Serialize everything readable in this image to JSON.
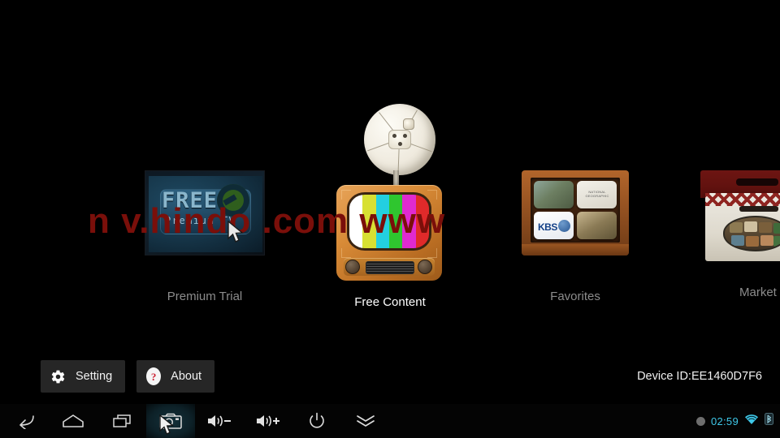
{
  "watermark": {
    "text": "n            v.hindo             .com            www"
  },
  "carousel": {
    "items": [
      {
        "id": "premium-trial",
        "label": "Premium Trial",
        "selected": false,
        "art": {
          "headline": "FREE",
          "subline": "Premium  TV",
          "icon": "free-premium-tv-logo"
        }
      },
      {
        "id": "free-content",
        "label": "Free Content",
        "selected": true,
        "art": {
          "icon": "retro-tv-with-satellite-dish",
          "color_bars": [
            "#ffffff",
            "#d8e033",
            "#23cfe0",
            "#2fc62f",
            "#e02ad0",
            "#e02a2a"
          ]
        }
      },
      {
        "id": "favorites",
        "label": "Favorites",
        "selected": false,
        "art": {
          "icon": "wooden-box-of-channel-tiles",
          "tiles": [
            "",
            "NATIONAL GEOGRAPHIC",
            "KBS",
            ""
          ]
        }
      },
      {
        "id": "market",
        "label": "Market",
        "selected": false,
        "art": {
          "icon": "shopping-bag"
        }
      }
    ]
  },
  "controls": {
    "setting_label": "Setting",
    "setting_icon": "gear-icon",
    "about_label": "About",
    "about_icon": "question-mark-icon",
    "device_id": "Device ID:EE1460D7F6"
  },
  "navbar": {
    "buttons": [
      {
        "id": "back",
        "icon": "back-arrow-icon",
        "active": false
      },
      {
        "id": "home",
        "icon": "home-icon",
        "active": false
      },
      {
        "id": "recents",
        "icon": "recent-apps-icon",
        "active": false
      },
      {
        "id": "screenshot",
        "icon": "camera-icon",
        "active": true
      },
      {
        "id": "volume-down",
        "icon": "volume-down-icon",
        "active": false
      },
      {
        "id": "volume-up",
        "icon": "volume-up-icon",
        "active": false
      },
      {
        "id": "power",
        "icon": "power-icon",
        "active": false
      },
      {
        "id": "collapse",
        "icon": "double-chevron-down-icon",
        "active": false
      }
    ],
    "status": {
      "indicator_icon": "status-dot-icon",
      "clock": "02:59",
      "wifi_icon": "wifi-icon",
      "bluetooth_icon": "bluetooth-icon"
    }
  },
  "colors": {
    "background": "#000000",
    "accent_cyan": "#3fc8e8",
    "watermark_red": "#7a0f0a",
    "button_bg": "#262626",
    "label_inactive": "#8c8c8c",
    "label_active": "#ffffff"
  }
}
